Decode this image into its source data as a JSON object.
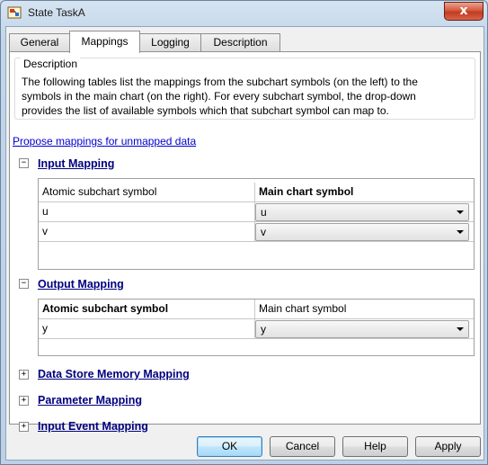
{
  "window": {
    "title": "State TaskA",
    "close_label": "x"
  },
  "tabs": [
    {
      "label": "General"
    },
    {
      "label": "Mappings"
    },
    {
      "label": "Logging"
    },
    {
      "label": "Description"
    }
  ],
  "active_tab": "Mappings",
  "description": {
    "legend": "Description",
    "lines": [
      "The following tables list the mappings from the subchart symbols (on the left) to the",
      "symbols in the main chart (on the right). For every subchart symbol, the drop-down",
      "provides the list of available symbols which that subchart symbol can map to."
    ]
  },
  "propose_link": "Propose mappings for unmapped data",
  "input_mapping": {
    "toggle": "−",
    "title": "Input Mapping",
    "headers": [
      "Atomic subchart symbol",
      "Main chart symbol"
    ],
    "rows": [
      {
        "symbol": "u",
        "mapped": "u"
      },
      {
        "symbol": "v",
        "mapped": "v"
      }
    ]
  },
  "output_mapping": {
    "toggle": "−",
    "title": "Output Mapping",
    "headers": [
      "Atomic subchart symbol",
      "Main chart symbol"
    ],
    "rows": [
      {
        "symbol": "y",
        "mapped": "y"
      }
    ]
  },
  "collapsed_sections": [
    {
      "toggle": "+",
      "title": "Data Store Memory Mapping"
    },
    {
      "toggle": "+",
      "title": "Parameter Mapping"
    },
    {
      "toggle": "+",
      "title": "Input Event Mapping"
    }
  ],
  "buttons": {
    "ok": "OK",
    "cancel": "Cancel",
    "help": "Help",
    "apply": "Apply"
  }
}
